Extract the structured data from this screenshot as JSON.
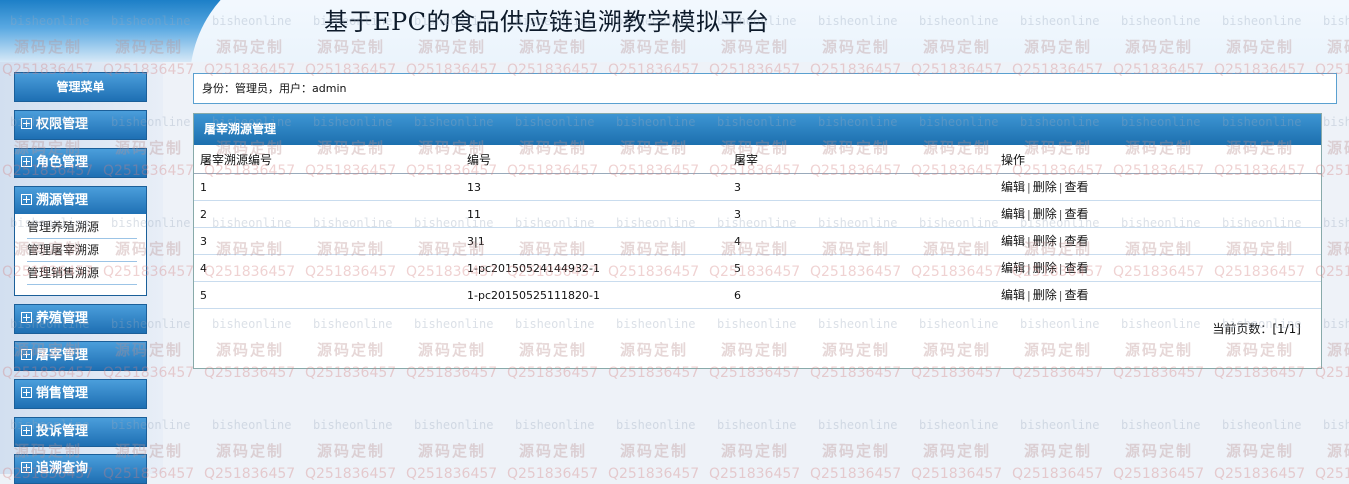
{
  "header": {
    "title": "基于EPC的食品供应链追溯教学模拟平台"
  },
  "menu": {
    "title": "管理菜单",
    "groups": [
      "权限管理",
      "角色管理",
      "溯源管理",
      "养殖管理",
      "屠宰管理",
      "销售管理",
      "投诉管理",
      "追溯查询"
    ],
    "trace_sub_items": [
      "管理养殖溯源",
      "管理屠宰溯源",
      "管理销售溯源"
    ]
  },
  "identity": {
    "text": "身份：管理员，用户：admin"
  },
  "panel": {
    "title": "屠宰溯源管理",
    "columns": [
      "屠宰溯源编号",
      "编号",
      "屠宰",
      "操作"
    ],
    "rows": [
      {
        "id": "1",
        "code": "13",
        "slaughter": "3"
      },
      {
        "id": "2",
        "code": "11",
        "slaughter": "3"
      },
      {
        "id": "3",
        "code": "3|1",
        "slaughter": "4"
      },
      {
        "id": "4",
        "code": "1-pc20150524144932-1",
        "slaughter": "5"
      },
      {
        "id": "5",
        "code": "1-pc20150525111820-1",
        "slaughter": "6"
      }
    ],
    "actions": {
      "edit": "编辑",
      "delete": "删除",
      "view": "查看",
      "sep": "|"
    },
    "pager": "当前页数：[1/1]"
  },
  "watermark": {
    "site": "bisheonline",
    "custom": "源码定制",
    "qq": "Q251836457"
  },
  "colors": {
    "accent": "#1e6fb3",
    "panel_header": "#2a82c4",
    "background": "#eef2f8"
  }
}
